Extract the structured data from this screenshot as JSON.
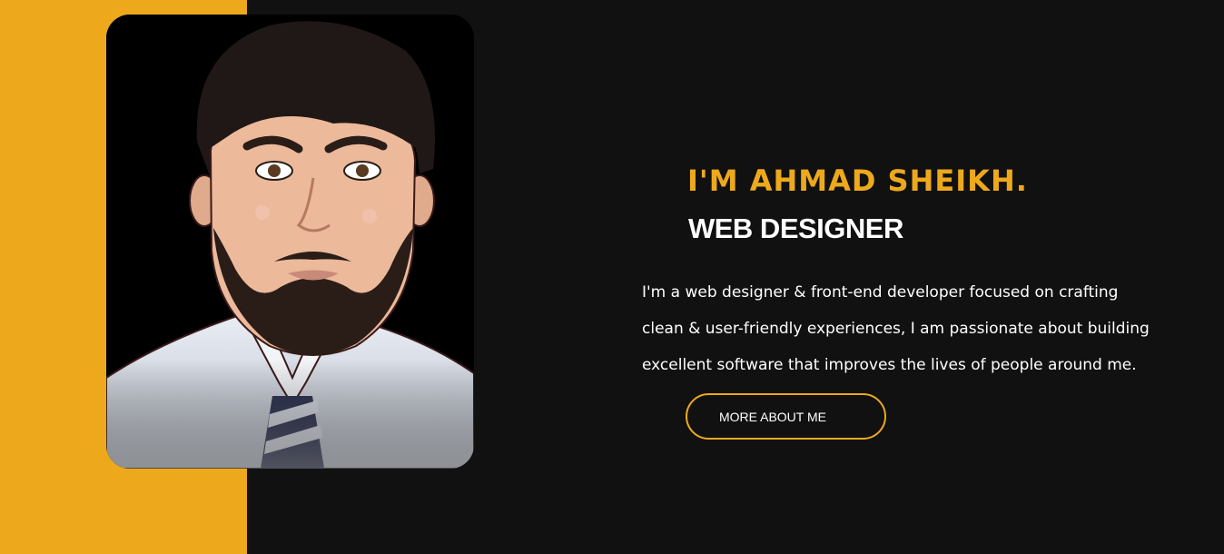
{
  "hero": {
    "intro": "I'M AHMAD SHEIKH.",
    "role": "WEB DESIGNER",
    "bio_lines": [
      "I'm a web designer & front-end developer focused on crafting",
      "clean & user-friendly experiences, I am passionate about building",
      "excellent software that improves the lives of people around me."
    ],
    "cta_label": "MORE ABOUT ME"
  },
  "colors": {
    "accent": "#EDA91B",
    "background": "#111111",
    "text": "#FFFFFF"
  }
}
